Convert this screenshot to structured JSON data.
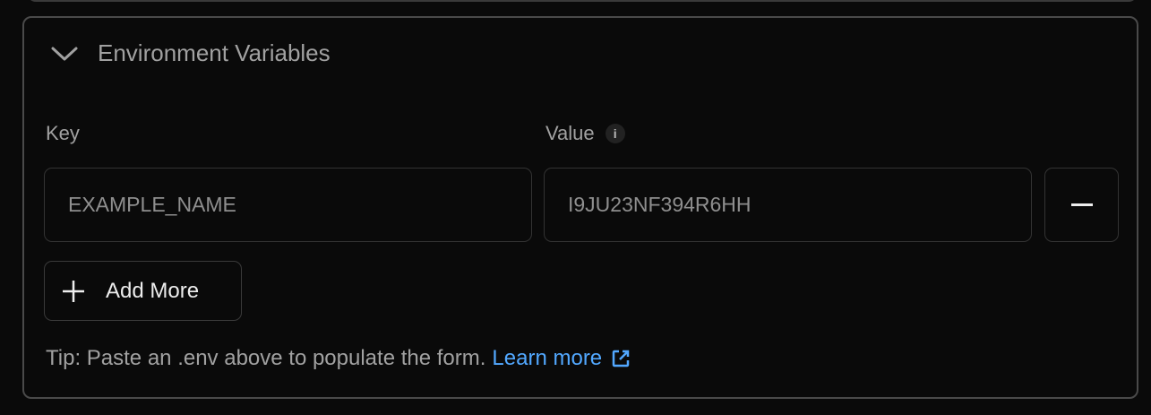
{
  "section": {
    "title": "Environment Variables",
    "expanded": true
  },
  "form": {
    "key_label": "Key",
    "value_label": "Value",
    "rows": [
      {
        "key_placeholder": "EXAMPLE_NAME",
        "value_placeholder": "I9JU23NF394R6HH"
      }
    ],
    "add_more_label": "Add More"
  },
  "tip": {
    "text": "Tip: Paste an .env above to populate the form.",
    "link_label": "Learn more"
  },
  "colors": {
    "link": "#52a8ff",
    "background": "#0a0a0a"
  }
}
